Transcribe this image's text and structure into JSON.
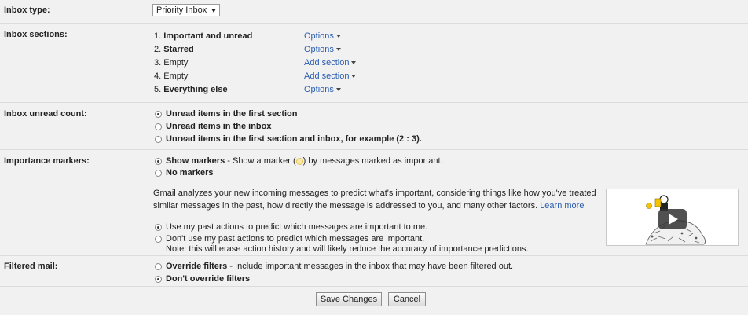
{
  "inbox_type": {
    "label": "Inbox type:",
    "selected": "Priority Inbox"
  },
  "inbox_sections": {
    "label": "Inbox sections:",
    "items": [
      {
        "num": "1.",
        "name": "Important and unread",
        "action": "Options"
      },
      {
        "num": "2.",
        "name": "Starred",
        "action": "Options"
      },
      {
        "num": "3.",
        "name": "Empty",
        "action": "Add section"
      },
      {
        "num": "4.",
        "name": "Empty",
        "action": "Add section"
      },
      {
        "num": "5.",
        "name": "Everything else",
        "action": "Options"
      }
    ]
  },
  "unread_count": {
    "label": "Inbox unread count:",
    "options": [
      "Unread items in the first section",
      "Unread items in the inbox",
      "Unread items in the first section and inbox, for example (2 : 3)."
    ],
    "selected_index": 0
  },
  "importance_markers": {
    "label": "Importance markers:",
    "show_bold": "Show markers",
    "show_desc_pre": " - Show a marker (",
    "show_desc_post": ") by messages marked as important.",
    "no_markers": "No markers",
    "para_line1": "Gmail analyzes your new incoming messages to predict what's important, considering things like how you've treated",
    "para_line2": "similar messages in the past, how directly the message is addressed to you, and many other factors.",
    "learn_more": "Learn more",
    "use_actions": "Use my past actions to predict which messages are important to me.",
    "dont_use_actions": "Don't use my past actions to predict which messages are important.",
    "note": "Note: this will erase action history and will likely reduce the accuracy of importance predictions.",
    "marker_color": "#fdeaa6"
  },
  "filtered_mail": {
    "label": "Filtered mail:",
    "override_bold": "Override filters",
    "override_desc": " - Include important messages in the inbox that may have been filtered out.",
    "dont_override": "Don't override filters"
  },
  "footer": {
    "save": "Save Changes",
    "cancel": "Cancel"
  }
}
